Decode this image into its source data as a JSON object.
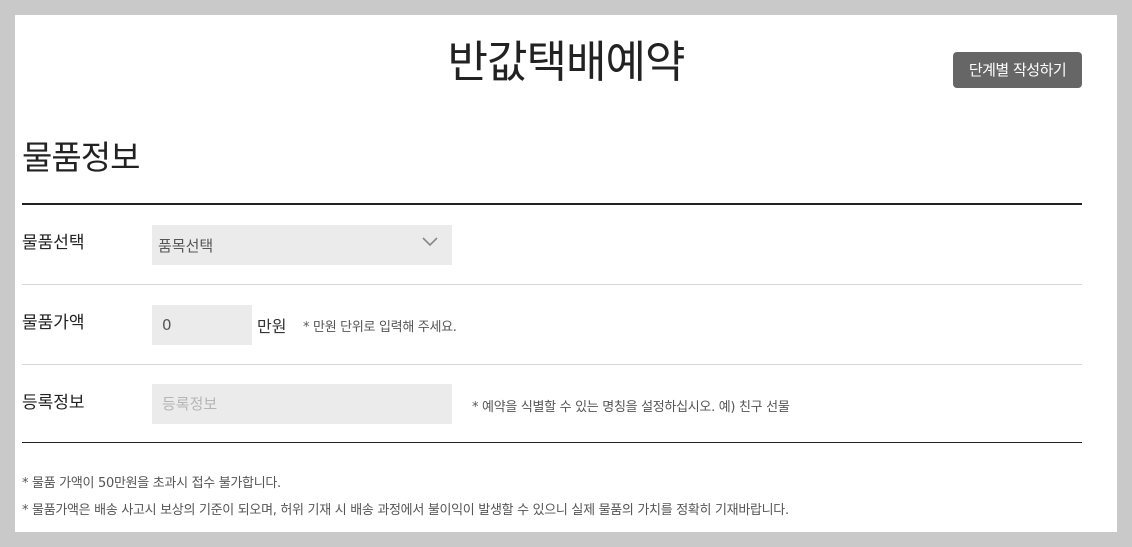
{
  "header": {
    "title": "반값택배예약",
    "step_button_label": "단계별 작성하기"
  },
  "section": {
    "title": "물품정보"
  },
  "form": {
    "item_select": {
      "label": "물품선택",
      "selected": "품목선택"
    },
    "item_price": {
      "label": "물품가액",
      "value": "0",
      "unit": "만원",
      "hint": "* 만원 단위로 입력해 주세요."
    },
    "registration": {
      "label": "등록정보",
      "placeholder": "등록정보",
      "hint": "* 예약을 식별할 수 있는 명칭을 설정하십시오. 예) 친구 선물"
    }
  },
  "notes": [
    "* 물품 가액이 50만원을 초과시 접수 불가합니다.",
    "* 물품가액은 배송 사고시 보상의 기준이 되오며, 허위 기재 시 배송 과정에서 불이익이 발생할 수 있으니 실제 물품의 가치를 정확히 기재바랍니다."
  ],
  "colors": {
    "page_bg": "#c9c9c9",
    "panel_bg": "#ffffff",
    "button_bg": "#666666",
    "field_bg": "#ebebeb"
  },
  "icons": {
    "select_arrow": "chevron-down-icon"
  }
}
